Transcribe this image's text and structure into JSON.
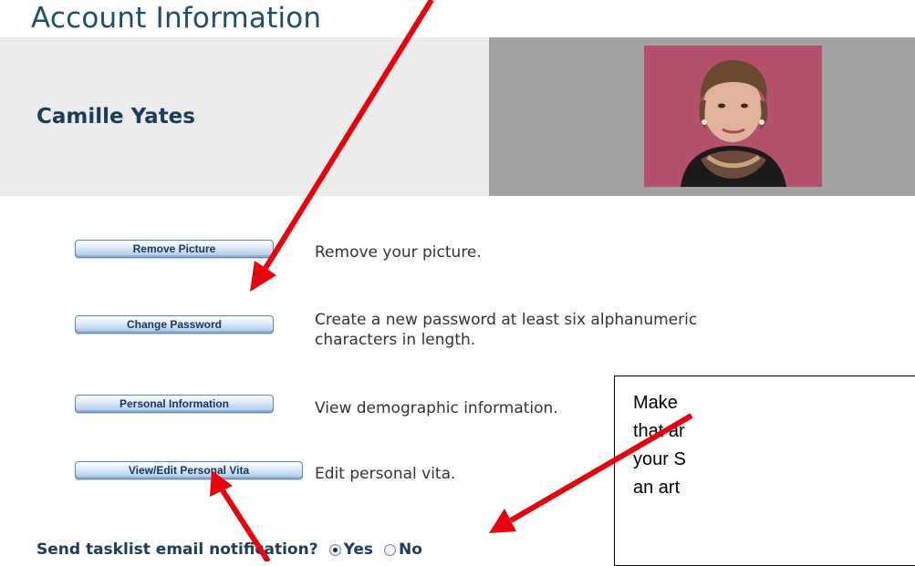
{
  "page": {
    "heading": "Account Information"
  },
  "profile": {
    "name": "Camille Yates"
  },
  "actions": [
    {
      "button": "Remove Picture",
      "description": "Remove your picture."
    },
    {
      "button": "Change Password",
      "description": "Create a new password at least six alphanumeric",
      "description_line2": "characters in length."
    },
    {
      "button": "Personal Information",
      "description": "View demographic information."
    },
    {
      "button": "View/Edit Personal Vita",
      "description": "Edit personal vita."
    }
  ],
  "notification": {
    "label": "Send tasklist email notification?",
    "options": [
      "Yes",
      "No"
    ],
    "selected": "Yes"
  },
  "callout": {
    "lines": [
      "Make",
      "that ar",
      "your S",
      "an art"
    ]
  },
  "colors": {
    "heading": "#1f4e6b",
    "name": "#1d3b5c",
    "arrow": "#e8000b",
    "photo_bg": "#b5506a"
  }
}
